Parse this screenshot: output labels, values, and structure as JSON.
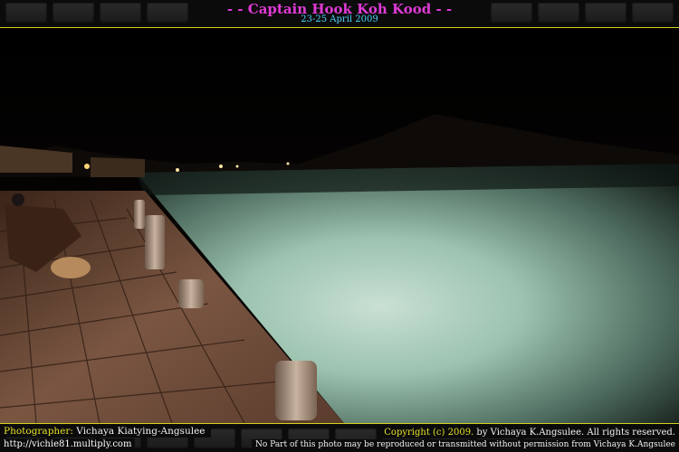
{
  "header": {
    "title": "- - Captain Hook Koh Kood - -",
    "date": "23-25 April 2009",
    "title_color": "#e03ad6",
    "date_color": "#4fd6ff"
  },
  "footer": {
    "photographer_label": "Photographer:",
    "photographer_name": "Vichaya Kiatying-Angsulee",
    "url": "http://vichie81.multiply.com",
    "copyright_prefix": "Copyright (c) 2009.",
    "copyright_suffix": "by Vichaya K.Angsulee. All rights reserved.",
    "notice": "No Part of this photo may be reproduced or transmitted without permission from Vichaya K.Angsulee"
  },
  "colors": {
    "frame_rule": "#d4d21a",
    "water": "#a9c9b8",
    "deck": "#6e4a38"
  }
}
